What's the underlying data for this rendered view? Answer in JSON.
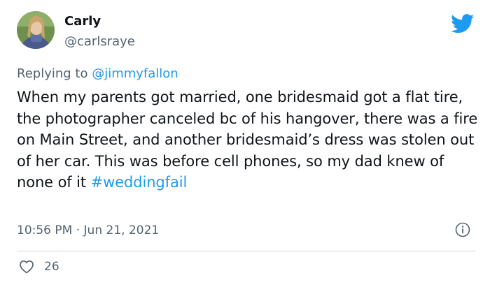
{
  "user": {
    "display_name": "Carly",
    "handle": "@carlsraye"
  },
  "reply": {
    "prefix": "Replying to ",
    "mention": "@jimmyfallon"
  },
  "tweet": {
    "text": "When my parents got married, one bridesmaid got a flat tire, the photographer canceled bc of his hangover, there was a fire on Main Street, and another bridesmaid’s dress was stolen out of her car. This was before cell phones, so my dad knew of none of it ",
    "hashtag": "#weddingfail"
  },
  "meta": {
    "time": "10:56 PM",
    "separator": " · ",
    "date": "Jun 21, 2021"
  },
  "stats": {
    "likes": "26"
  },
  "icons": {
    "brand": "twitter-bird-icon",
    "info": "info-icon",
    "like": "heart-icon"
  },
  "colors": {
    "brand_blue": "#1d9bf0",
    "text": "#0f1419",
    "secondary_text": "#536471",
    "divider": "#cfd9de"
  }
}
